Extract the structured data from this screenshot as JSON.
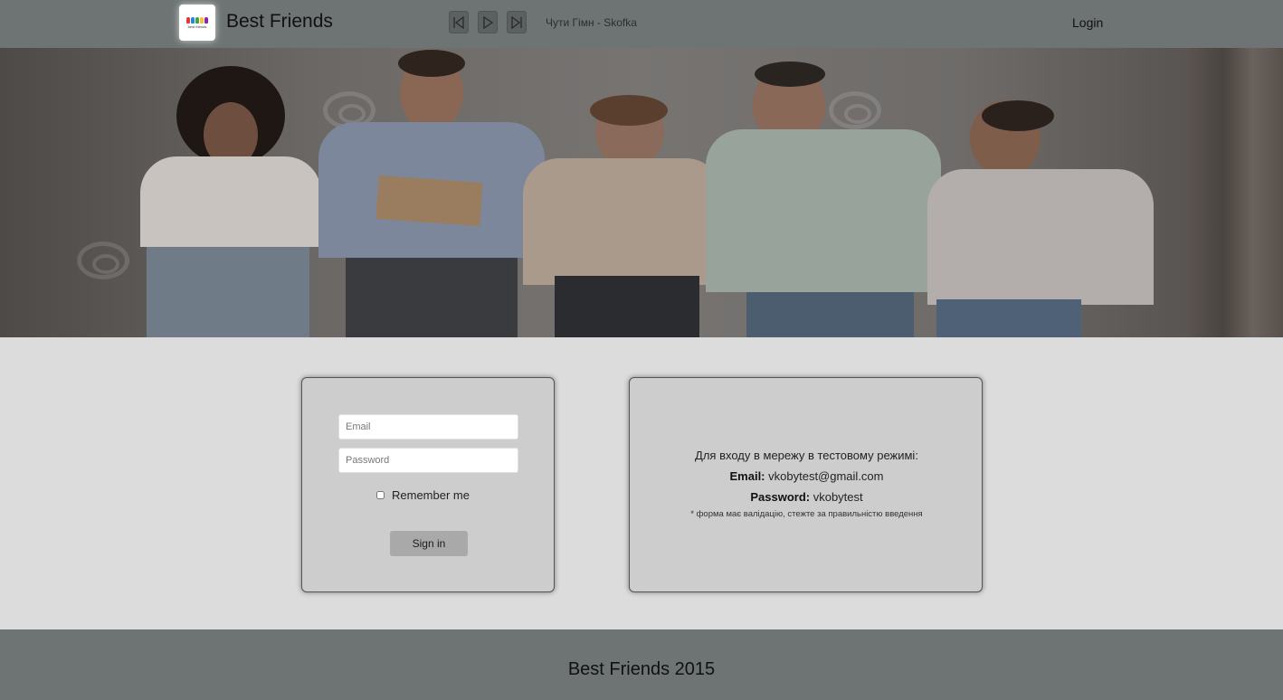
{
  "header": {
    "brand": "Best Friends",
    "logo_caption": "best friends",
    "track": "Чути Гімн - Skofka",
    "login": "Login",
    "player": {
      "prev_icon": "skip-back-icon",
      "play_icon": "play-icon",
      "next_icon": "skip-forward-icon"
    }
  },
  "login_form": {
    "email_placeholder": "Email",
    "password_placeholder": "Password",
    "remember_label": "Remember me",
    "signin_label": "Sign in"
  },
  "info": {
    "intro": "Для входу в мережу в тестовому режимі:",
    "email_label": "Email:",
    "email_value": "vkobytest@gmail.com",
    "password_label": "Password:",
    "password_value": "vkobytest",
    "note": "* форма має валідацію, стежте за правильністю введення"
  },
  "footer": {
    "text": "Best Friends 2015"
  },
  "colors": {
    "header_bg": "#6d7473",
    "page_bg": "#dcdcdc",
    "card_bg": "#cdcdcd",
    "button_bg": "#a9a9a9"
  }
}
